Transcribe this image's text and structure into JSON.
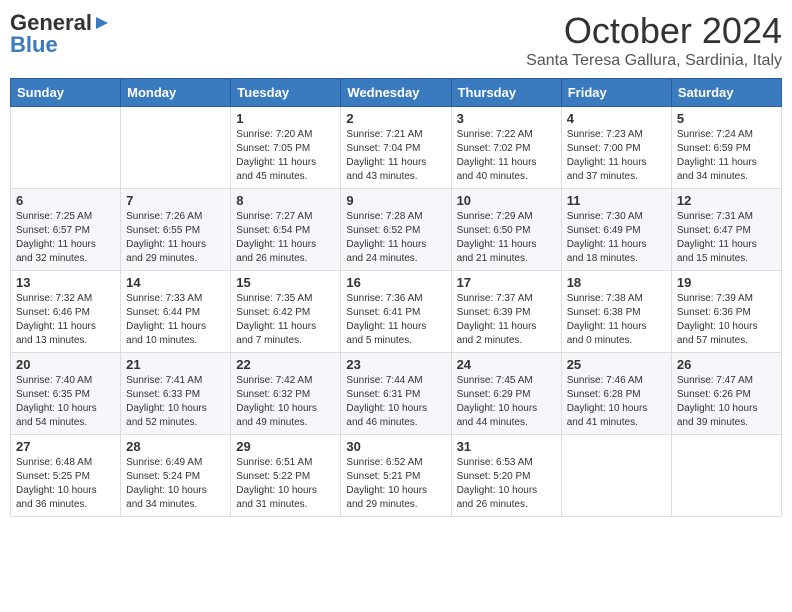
{
  "logo": {
    "general": "General",
    "blue": "Blue",
    "icon": "▶"
  },
  "title": "October 2024",
  "subtitle": "Santa Teresa Gallura, Sardinia, Italy",
  "days_of_week": [
    "Sunday",
    "Monday",
    "Tuesday",
    "Wednesday",
    "Thursday",
    "Friday",
    "Saturday"
  ],
  "weeks": [
    [
      {
        "day": "",
        "info": ""
      },
      {
        "day": "",
        "info": ""
      },
      {
        "day": "1",
        "info": "Sunrise: 7:20 AM\nSunset: 7:05 PM\nDaylight: 11 hours and 45 minutes."
      },
      {
        "day": "2",
        "info": "Sunrise: 7:21 AM\nSunset: 7:04 PM\nDaylight: 11 hours and 43 minutes."
      },
      {
        "day": "3",
        "info": "Sunrise: 7:22 AM\nSunset: 7:02 PM\nDaylight: 11 hours and 40 minutes."
      },
      {
        "day": "4",
        "info": "Sunrise: 7:23 AM\nSunset: 7:00 PM\nDaylight: 11 hours and 37 minutes."
      },
      {
        "day": "5",
        "info": "Sunrise: 7:24 AM\nSunset: 6:59 PM\nDaylight: 11 hours and 34 minutes."
      }
    ],
    [
      {
        "day": "6",
        "info": "Sunrise: 7:25 AM\nSunset: 6:57 PM\nDaylight: 11 hours and 32 minutes."
      },
      {
        "day": "7",
        "info": "Sunrise: 7:26 AM\nSunset: 6:55 PM\nDaylight: 11 hours and 29 minutes."
      },
      {
        "day": "8",
        "info": "Sunrise: 7:27 AM\nSunset: 6:54 PM\nDaylight: 11 hours and 26 minutes."
      },
      {
        "day": "9",
        "info": "Sunrise: 7:28 AM\nSunset: 6:52 PM\nDaylight: 11 hours and 24 minutes."
      },
      {
        "day": "10",
        "info": "Sunrise: 7:29 AM\nSunset: 6:50 PM\nDaylight: 11 hours and 21 minutes."
      },
      {
        "day": "11",
        "info": "Sunrise: 7:30 AM\nSunset: 6:49 PM\nDaylight: 11 hours and 18 minutes."
      },
      {
        "day": "12",
        "info": "Sunrise: 7:31 AM\nSunset: 6:47 PM\nDaylight: 11 hours and 15 minutes."
      }
    ],
    [
      {
        "day": "13",
        "info": "Sunrise: 7:32 AM\nSunset: 6:46 PM\nDaylight: 11 hours and 13 minutes."
      },
      {
        "day": "14",
        "info": "Sunrise: 7:33 AM\nSunset: 6:44 PM\nDaylight: 11 hours and 10 minutes."
      },
      {
        "day": "15",
        "info": "Sunrise: 7:35 AM\nSunset: 6:42 PM\nDaylight: 11 hours and 7 minutes."
      },
      {
        "day": "16",
        "info": "Sunrise: 7:36 AM\nSunset: 6:41 PM\nDaylight: 11 hours and 5 minutes."
      },
      {
        "day": "17",
        "info": "Sunrise: 7:37 AM\nSunset: 6:39 PM\nDaylight: 11 hours and 2 minutes."
      },
      {
        "day": "18",
        "info": "Sunrise: 7:38 AM\nSunset: 6:38 PM\nDaylight: 11 hours and 0 minutes."
      },
      {
        "day": "19",
        "info": "Sunrise: 7:39 AM\nSunset: 6:36 PM\nDaylight: 10 hours and 57 minutes."
      }
    ],
    [
      {
        "day": "20",
        "info": "Sunrise: 7:40 AM\nSunset: 6:35 PM\nDaylight: 10 hours and 54 minutes."
      },
      {
        "day": "21",
        "info": "Sunrise: 7:41 AM\nSunset: 6:33 PM\nDaylight: 10 hours and 52 minutes."
      },
      {
        "day": "22",
        "info": "Sunrise: 7:42 AM\nSunset: 6:32 PM\nDaylight: 10 hours and 49 minutes."
      },
      {
        "day": "23",
        "info": "Sunrise: 7:44 AM\nSunset: 6:31 PM\nDaylight: 10 hours and 46 minutes."
      },
      {
        "day": "24",
        "info": "Sunrise: 7:45 AM\nSunset: 6:29 PM\nDaylight: 10 hours and 44 minutes."
      },
      {
        "day": "25",
        "info": "Sunrise: 7:46 AM\nSunset: 6:28 PM\nDaylight: 10 hours and 41 minutes."
      },
      {
        "day": "26",
        "info": "Sunrise: 7:47 AM\nSunset: 6:26 PM\nDaylight: 10 hours and 39 minutes."
      }
    ],
    [
      {
        "day": "27",
        "info": "Sunrise: 6:48 AM\nSunset: 5:25 PM\nDaylight: 10 hours and 36 minutes."
      },
      {
        "day": "28",
        "info": "Sunrise: 6:49 AM\nSunset: 5:24 PM\nDaylight: 10 hours and 34 minutes."
      },
      {
        "day": "29",
        "info": "Sunrise: 6:51 AM\nSunset: 5:22 PM\nDaylight: 10 hours and 31 minutes."
      },
      {
        "day": "30",
        "info": "Sunrise: 6:52 AM\nSunset: 5:21 PM\nDaylight: 10 hours and 29 minutes."
      },
      {
        "day": "31",
        "info": "Sunrise: 6:53 AM\nSunset: 5:20 PM\nDaylight: 10 hours and 26 minutes."
      },
      {
        "day": "",
        "info": ""
      },
      {
        "day": "",
        "info": ""
      }
    ]
  ]
}
